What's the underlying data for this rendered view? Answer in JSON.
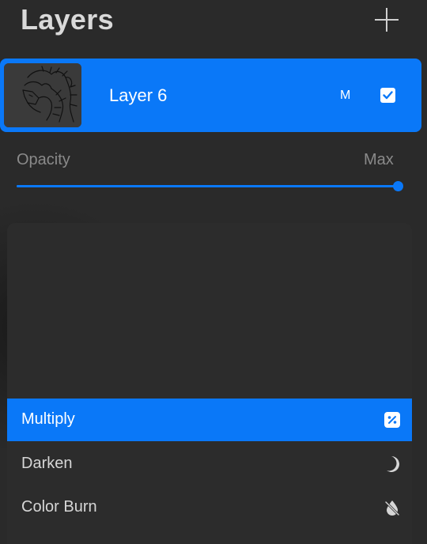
{
  "header": {
    "title": "Layers",
    "add_icon": "plus-icon"
  },
  "layer": {
    "name": "Layer 6",
    "blend_mode_letter": "M",
    "visible": true,
    "thumbnail": "dragon-sketch-thumbnail"
  },
  "opacity": {
    "label": "Opacity",
    "value_label": "Max",
    "value": 1.0
  },
  "blend_modes": {
    "items": [
      {
        "label": "Multiply",
        "icon": "multiply-icon",
        "selected": true
      },
      {
        "label": "Darken",
        "icon": "moon-icon",
        "selected": false
      },
      {
        "label": "Color Burn",
        "icon": "burn-drop-icon",
        "selected": false
      }
    ]
  },
  "colors": {
    "accent": "#0a78f8",
    "background": "#2a2a2a",
    "text": "#d9d9d9",
    "muted": "#8a8a8a"
  }
}
